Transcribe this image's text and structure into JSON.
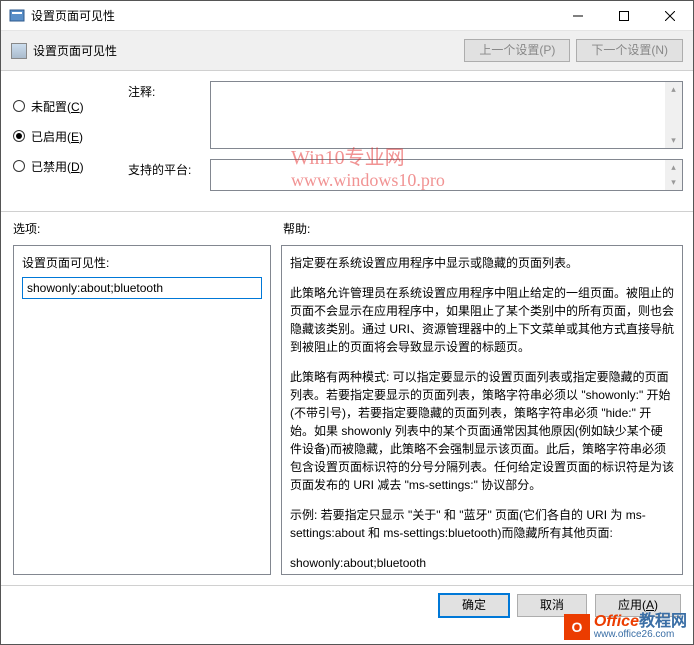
{
  "window": {
    "title": "设置页面可见性"
  },
  "toolbar": {
    "label": "设置页面可见性",
    "prev_btn": "上一个设置(P)",
    "next_btn": "下一个设置(N)"
  },
  "radios": {
    "not_configured": "未配置(C)",
    "enabled": "已启用(E)",
    "disabled": "已禁用(D)"
  },
  "fields": {
    "comment_label": "注释:",
    "platform_label": "支持的平台:"
  },
  "section": {
    "options_label": "选项:",
    "help_label": "帮助:"
  },
  "left_pane": {
    "label": "设置页面可见性:",
    "value": "showonly:about;bluetooth"
  },
  "help": {
    "p1": "指定要在系统设置应用程序中显示或隐藏的页面列表。",
    "p2": "此策略允许管理员在系统设置应用程序中阻止给定的一组页面。被阻止的页面不会显示在应用程序中，如果阻止了某个类别中的所有页面，则也会隐藏该类别。通过 URI、资源管理器中的上下文菜单或其他方式直接导航到被阻止的页面将会导致显示设置的标题页。",
    "p3": "此策略有两种模式: 可以指定要显示的设置页面列表或指定要隐藏的页面列表。若要指定要显示的页面列表，策略字符串必须以 \"showonly:\" 开始(不带引号)，若要指定要隐藏的页面列表，策略字符串必须 \"hide:\" 开始。如果 showonly 列表中的某个页面通常因其他原因(例如缺少某个硬件设备)而被隐藏，此策略不会强制显示该页面。此后，策略字符串必须包含设置页面标识符的分号分隔列表。任何给定设置页面的标识符是为该页面发布的 URI 减去 \"ms-settings:\" 协议部分。",
    "p4": "示例: 若要指定只显示 \"关于\" 和 \"蓝牙\" 页面(它们各自的 URI 为 ms-settings:about 和 ms-settings:bluetooth)而隐藏所有其他页面:",
    "p5": "showonly:about;bluetooth"
  },
  "buttons": {
    "ok": "确定",
    "cancel": "取消",
    "apply": "应用(A)"
  },
  "watermark": {
    "l1": "Win10专业网",
    "l2": "www.windows10.pro",
    "brand1": "Office",
    "brand2": "教程网",
    "url": "www.office26.com"
  }
}
